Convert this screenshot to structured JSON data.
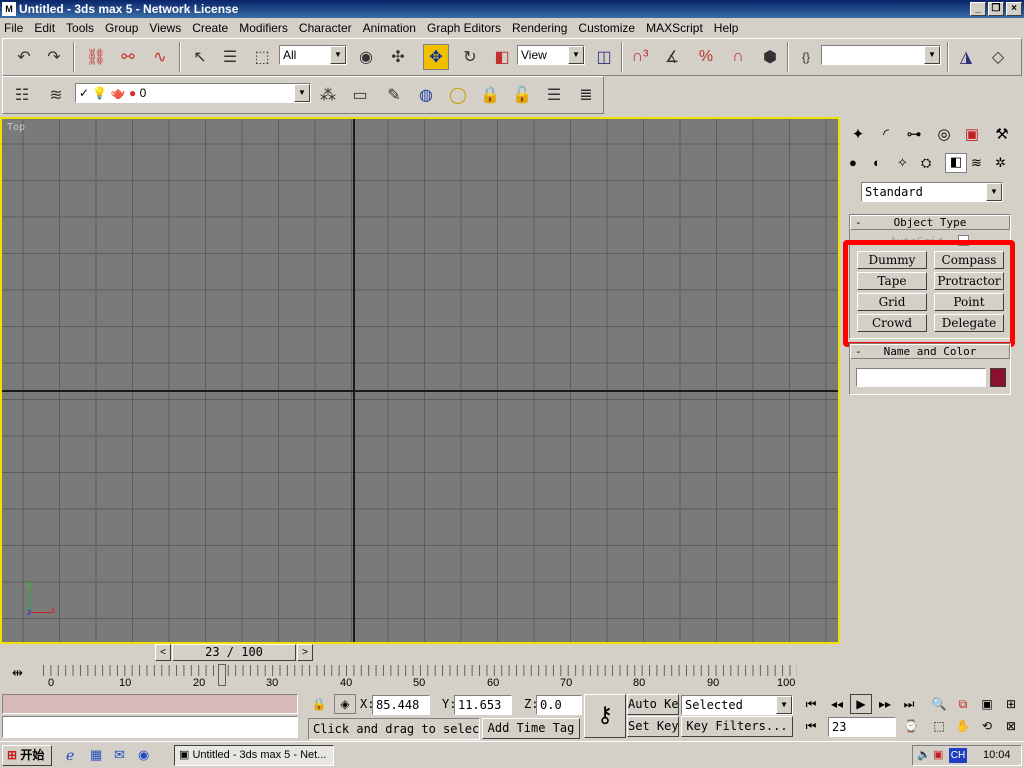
{
  "window": {
    "title": "Untitled - 3ds max 5 - Network License",
    "app_icon": "3ds-max-icon"
  },
  "menu": [
    "File",
    "Edit",
    "Tools",
    "Group",
    "Views",
    "Create",
    "Modifiers",
    "Character",
    "Animation",
    "Graph Editors",
    "Rendering",
    "Customize",
    "MAXScript",
    "Help"
  ],
  "toolbar": {
    "selection_filter": "All",
    "reference_coord": "View",
    "named_selection": ""
  },
  "layer_toolbar": {
    "current_layer": "0"
  },
  "viewport": {
    "label": "Top",
    "axis_y": "y",
    "axis_x": "x",
    "axis_z": "z"
  },
  "command_panel": {
    "category_dropdown": "Standard",
    "object_type_title": "Object Type",
    "autogrid_label": "AutoGrid",
    "buttons": [
      "Dummy",
      "Compass",
      "Tape",
      "Protractor",
      "Grid",
      "Point",
      "Crowd",
      "Delegate"
    ],
    "name_color_title": "Name and Color",
    "object_name": "",
    "object_color": "#8b1030"
  },
  "time_slider": {
    "label": "23 / 100"
  },
  "ruler": {
    "ticks": [
      "0",
      "10",
      "20",
      "30",
      "40",
      "50",
      "60",
      "70",
      "80",
      "90",
      "100"
    ]
  },
  "status": {
    "x_label": "X:",
    "x_value": "85.448",
    "y_label": "Y:",
    "y_value": "11.653",
    "z_label": "Z:",
    "z_value": "0.0",
    "prompt": "Click and drag to select",
    "add_time_tag": "Add Time Tag",
    "auto_key": "Auto Key",
    "set_key": "Set Key",
    "selection_mode": "Selected",
    "key_filters": "Key Filters...",
    "current_frame": "23"
  },
  "taskbar": {
    "start": "开始",
    "task_item": "Untitled - 3ds max 5 - Net...",
    "ime": "CH",
    "clock": "10:04"
  }
}
